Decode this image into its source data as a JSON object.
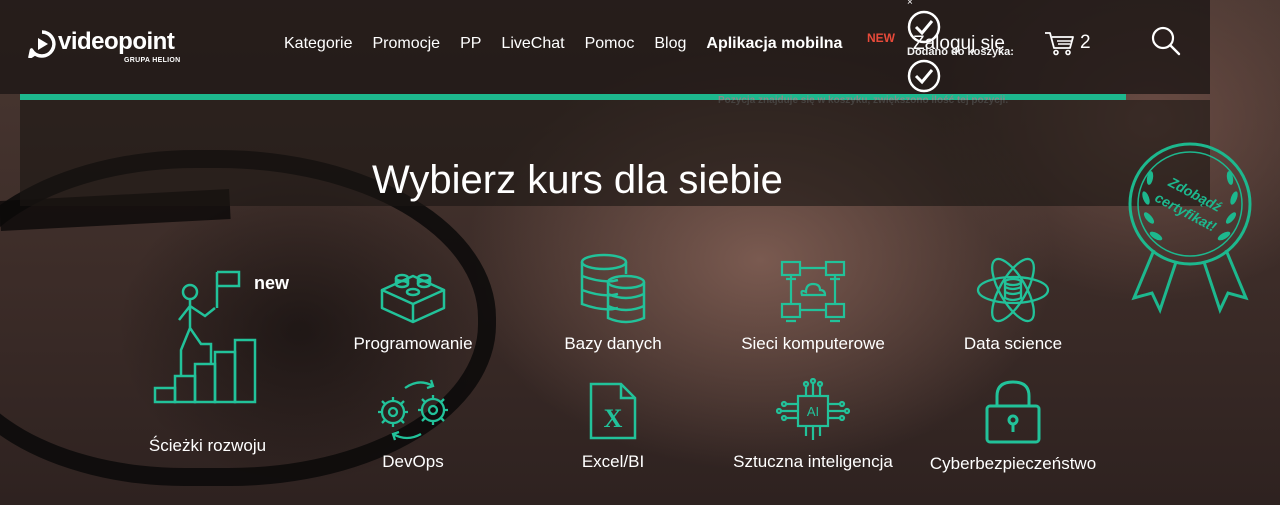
{
  "brand": {
    "name": "videopoint",
    "subtitle": "GRUPA HELION"
  },
  "nav": {
    "items": [
      "Kategorie",
      "Promocje",
      "PP",
      "LiveChat",
      "Pomoc",
      "Blog"
    ],
    "mobile_app": "Aplikacja mobilna",
    "new_badge": "NEW",
    "login": "Zaloguj się"
  },
  "cart": {
    "count": "2"
  },
  "cart_popup": {
    "close": "×",
    "title": "Dodano do koszyka:",
    "message": "Pozycja znajduje się w koszyku, zwiększono ilość tej pozycji."
  },
  "hero": {
    "title": "Wybierz kurs dla siebie"
  },
  "certificate_badge": {
    "text_line1": "Zdobądź",
    "text_line2": "certyfikat!"
  },
  "categories": {
    "featured": {
      "label": "Ścieżki rozwoju",
      "tag": "new",
      "icon": "career-path-icon"
    },
    "items": [
      {
        "label": "Programowanie",
        "icon": "building-blocks-icon"
      },
      {
        "label": "Bazy danych",
        "icon": "database-icon"
      },
      {
        "label": "Sieci komputerowe",
        "icon": "network-icon"
      },
      {
        "label": "Data science",
        "icon": "atom-icon"
      },
      {
        "label": "DevOps",
        "icon": "gears-icon"
      },
      {
        "label": "Excel/BI",
        "icon": "excel-file-icon"
      },
      {
        "label": "Sztuczna inteligencja",
        "icon": "ai-chip-icon"
      },
      {
        "label": "Cyberbezpieczeństwo",
        "icon": "padlock-icon"
      }
    ]
  },
  "colors": {
    "accent": "#1db88e",
    "new_badge": "#e84a3a",
    "icon": "#22c29a"
  }
}
